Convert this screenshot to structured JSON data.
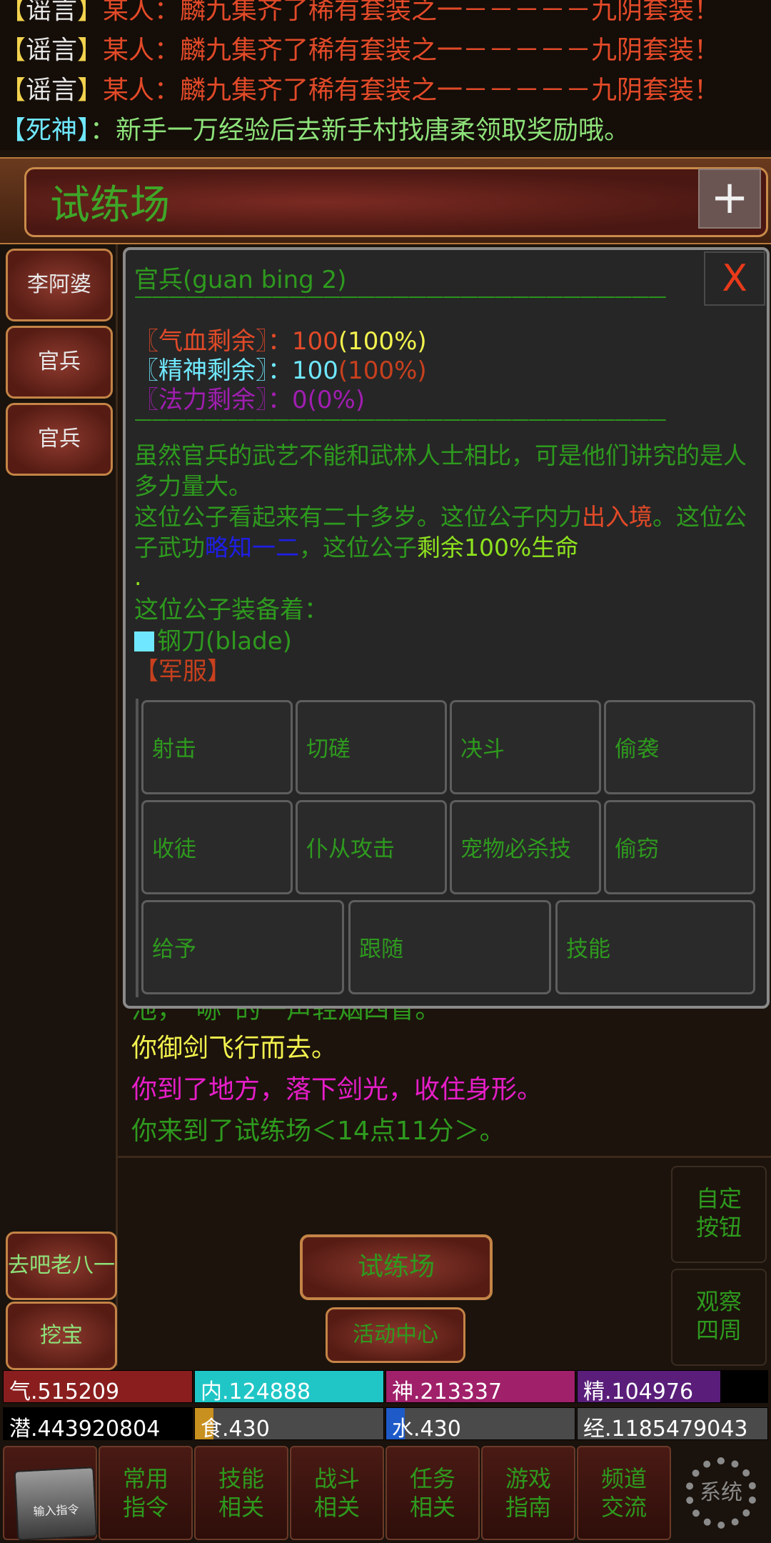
{
  "chat": [
    {
      "bracket": "【",
      "tag": "谣言",
      "bracket_end": "】",
      "text": "某人：麟九集齐了稀有套装之一－－－－－九阴套装！",
      "type": "rumor"
    },
    {
      "bracket": "【",
      "tag": "谣言",
      "bracket_end": "】",
      "text": "某人：麟九集齐了稀有套装之一－－－－－九阴套装！",
      "type": "rumor"
    },
    {
      "bracket": "【",
      "tag": "谣言",
      "bracket_end": "】",
      "text": "某人：麟九集齐了稀有套装之一－－－－－九阴套装！",
      "type": "rumor"
    },
    {
      "bracket": "【",
      "tag": "死神",
      "bracket_end": "】",
      "text": "：新手一万经验后去新手村找唐柔领取奖励哦。",
      "type": "death"
    }
  ],
  "location": {
    "title": "试练场",
    "plus": "+"
  },
  "npcs": [
    "李阿婆",
    "官兵",
    "官兵"
  ],
  "dialog": {
    "title": "官兵(guan bing 2)",
    "close": "X",
    "separator": "———————————————————————————————",
    "hp": {
      "label": "〖气血剩余〗：",
      "value": "100",
      "pct": "(100%)"
    },
    "spirit": {
      "label": "〖精神剩余〗：",
      "value": "100",
      "pct": "(100%)"
    },
    "mana": {
      "label": "〖法力剩余〗：",
      "value": "0",
      "pct": "(0%)"
    },
    "desc1": "虽然官兵的武艺不能和武林人士相比，可是他们讲究的是人多力量大。",
    "desc2_a": "这位公子看起来有二十多岁。这位公子内力",
    "desc2_b": "出入境",
    "desc2_c": "。这位公子武功",
    "desc2_d": "略知一二",
    "desc2_e": "，这位公子",
    "desc2_f": "剩余100%生命",
    "dot": ".",
    "equip_title": "这位公子装备着：",
    "weapon": "钢刀(blade)",
    "armor": "【军服】",
    "actions": [
      "射击",
      "切磋",
      "决斗",
      "偷袭",
      "收徒",
      "仆从攻击",
      "宠物必杀技",
      "偷窃",
      "给予",
      "跟随",
      "技能"
    ]
  },
  "messages": {
    "partial": "池，“哧”的一声轻烟四冒。",
    "fly": "你御剑飞行而去。",
    "land": "你到了地方，落下剑光，收住身形。",
    "arrive": "你来到了试练场＜14点11分＞。"
  },
  "side_buttons": [
    {
      "l1": "自定",
      "l2": "按钮"
    },
    {
      "l1": "观察",
      "l2": "四周"
    }
  ],
  "lower_left": [
    "去吧老八一",
    "挖宝"
  ],
  "center": {
    "main": "试练场",
    "sub": "活动中心"
  },
  "stats": {
    "qi": {
      "text": "气.515209",
      "fill": 1.0,
      "color": "#8a1e1e"
    },
    "nei": {
      "text": "内.124888",
      "fill": 1.0,
      "color": "#20c6c6"
    },
    "shen": {
      "text": "神.213337",
      "fill": 1.0,
      "color": "#a0206a"
    },
    "jing": {
      "text": "精.104976",
      "fill": 0.75,
      "color": "#5a1e7a"
    },
    "qian": {
      "text": "潜.443920804",
      "fill": 0.0,
      "color": "#000000"
    },
    "shi": {
      "text": "食.430",
      "fill": 0.1,
      "color": "#c8901e"
    },
    "shui": {
      "text": "水.430",
      "fill": 0.1,
      "color": "#1e5ac8"
    },
    "exp": {
      "text": "经.1185479043",
      "fill": 0.0,
      "color": "#4a4a4a"
    }
  },
  "menu": {
    "input_cmd": "输入指令",
    "items": [
      {
        "l1": "常用",
        "l2": "指令"
      },
      {
        "l1": "技能",
        "l2": "相关"
      },
      {
        "l1": "战斗",
        "l2": "相关"
      },
      {
        "l1": "任务",
        "l2": "相关"
      },
      {
        "l1": "游戏",
        "l2": "指南"
      },
      {
        "l1": "频道",
        "l2": "交流"
      }
    ],
    "system": "系统"
  }
}
